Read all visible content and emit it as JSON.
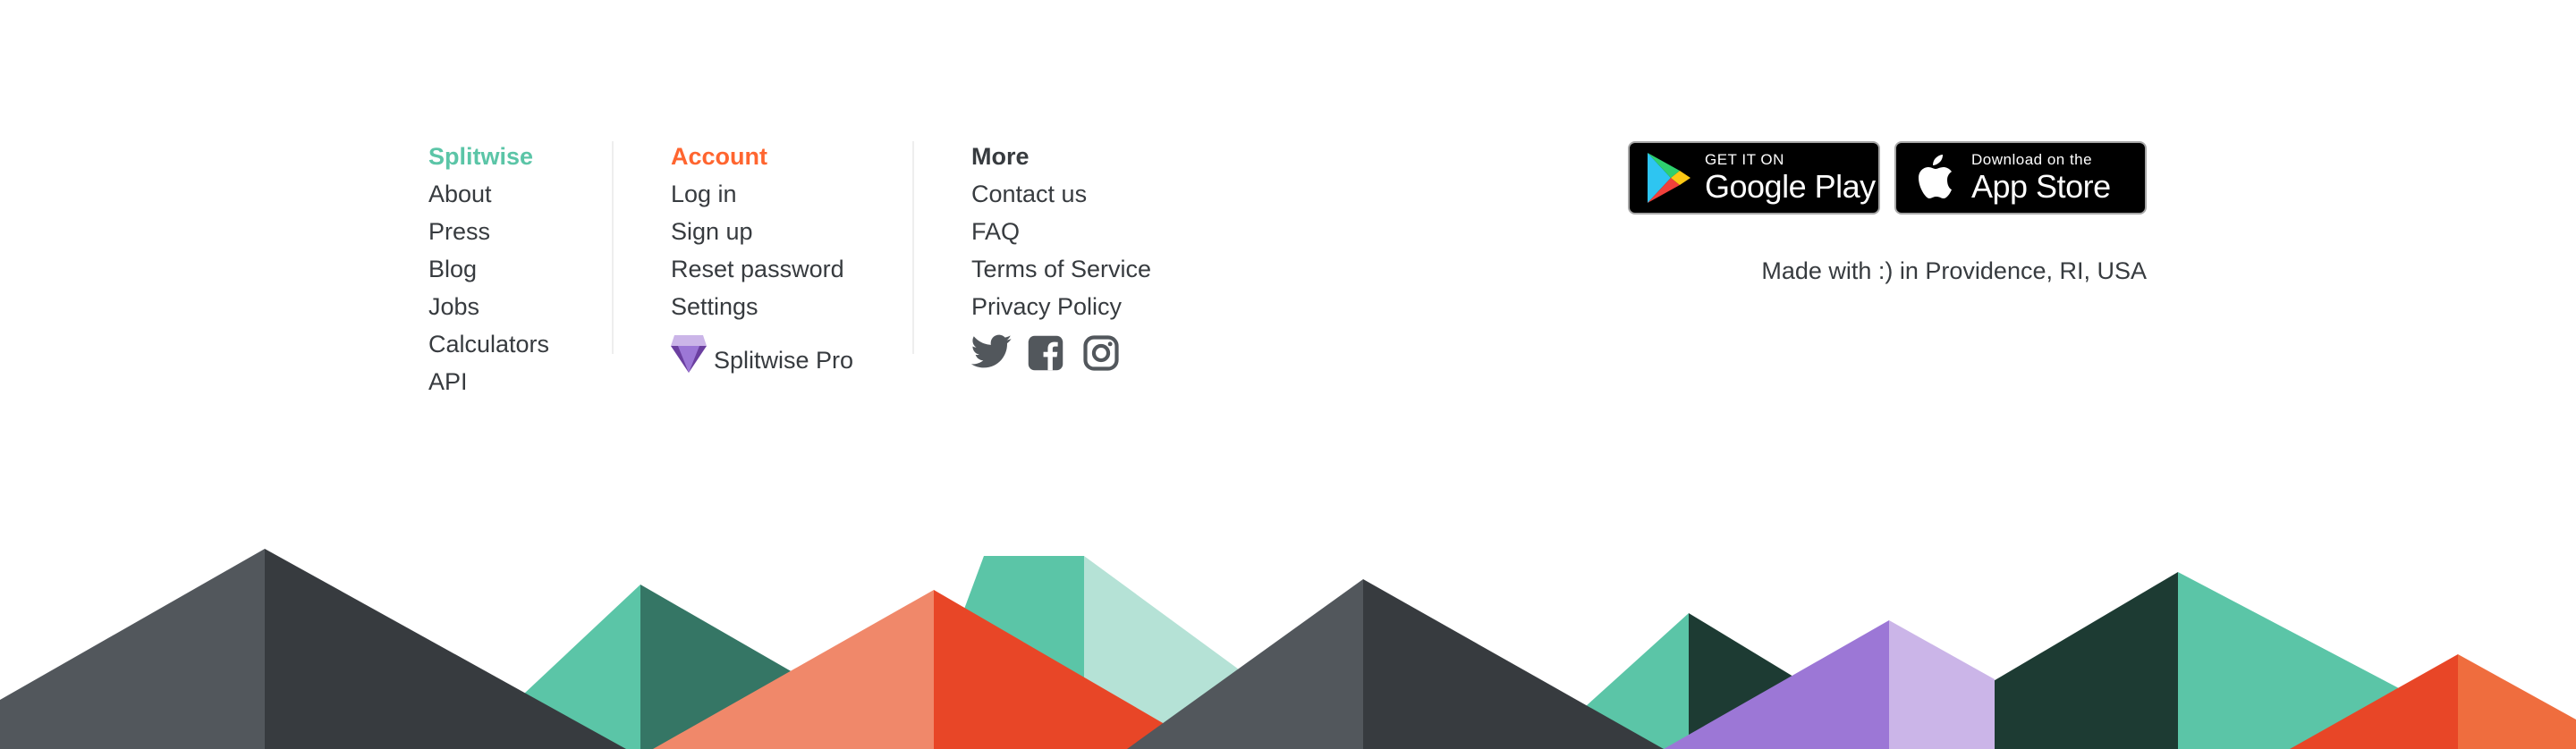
{
  "columns": {
    "splitwise": {
      "title": "Splitwise",
      "links": [
        "About",
        "Press",
        "Blog",
        "Jobs",
        "Calculators",
        "API"
      ]
    },
    "account": {
      "title": "Account",
      "links": [
        "Log in",
        "Sign up",
        "Reset password",
        "Settings"
      ],
      "pro_label": "Splitwise Pro"
    },
    "more": {
      "title": "More",
      "links": [
        "Contact us",
        "FAQ",
        "Terms of Service",
        "Privacy Policy"
      ],
      "social_icons": [
        "twitter-icon",
        "facebook-icon",
        "instagram-icon"
      ]
    }
  },
  "stores": {
    "google": {
      "small": "GET IT ON",
      "big": "Google Play",
      "icon": "google-play-icon"
    },
    "apple": {
      "small": "Download on the",
      "big": "App Store",
      "icon": "apple-icon"
    }
  },
  "made_with": "Made with :) in Providence, RI, USA",
  "colors": {
    "splitwise_teal": "#5bc5a7",
    "account_orange": "#ff652f",
    "text_dark": "#373b3f",
    "gray": "#52575c",
    "dark": "#373b3f",
    "deep_green": "#1d3b33",
    "forest": "#357665",
    "mint": "#b5e2d6",
    "coral": "#f0886a",
    "red": "#e84627",
    "orange": "#ef6d3e",
    "purple": "#9c77d6",
    "lavender": "#cbb5e8"
  }
}
